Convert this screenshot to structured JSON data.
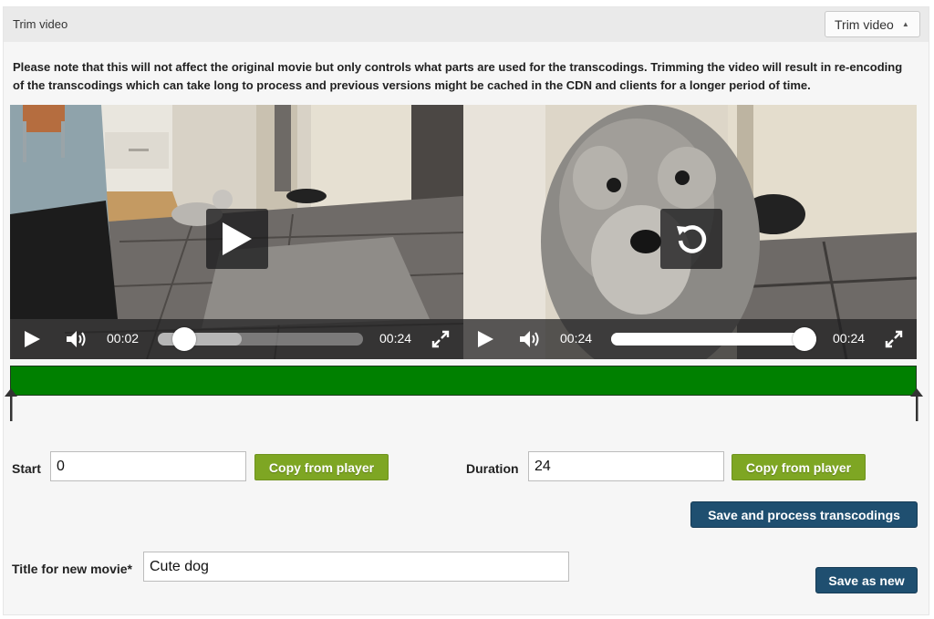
{
  "panel": {
    "title": "Trim video",
    "dropdown_label": "Trim video",
    "dropdown_icon": "caret-up-icon"
  },
  "notice": "Please note that this will not affect the original movie but only controls what parts are used for the transcodings. Trimming the video will result in re-encoding of the transcodings which can take long to process and previous versions might be cached in the CDN and clients for a longer period of time.",
  "players": {
    "left": {
      "overlay_icon": "play-icon",
      "current_time": "00:02",
      "duration": "00:24",
      "progress": 0.08
    },
    "right": {
      "overlay_icon": "replay-icon",
      "current_time": "00:24",
      "duration": "00:24",
      "progress": 1.0
    }
  },
  "trim": {
    "start_fraction": 0,
    "end_fraction": 1,
    "bar_color": "#008000"
  },
  "form": {
    "start_label": "Start",
    "start_value": "0",
    "duration_label": "Duration",
    "duration_value": "24",
    "copy_label": "Copy from player",
    "save_process_label": "Save and process transcodings",
    "title_label": "Title for new movie*",
    "title_value": "Cute dog",
    "save_new_label": "Save as new"
  },
  "colors": {
    "accent_green": "#7ea623",
    "primary_blue": "#1f4f70"
  }
}
